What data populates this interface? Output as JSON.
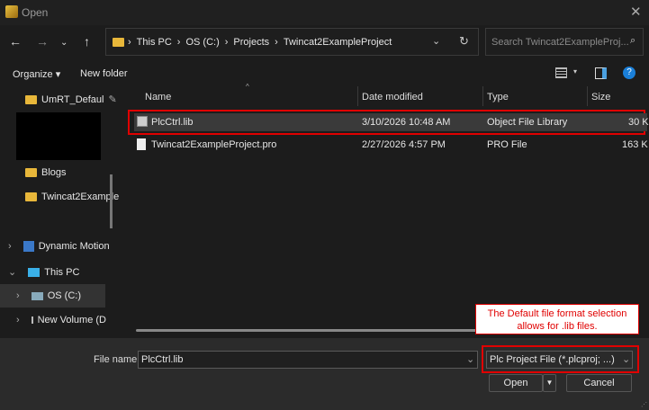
{
  "window": {
    "title": "Open"
  },
  "address": {
    "crumbs": [
      "This PC",
      "OS (C:)",
      "Projects",
      "Twincat2ExampleProject"
    ],
    "search_placeholder": "Search Twincat2ExampleProj..."
  },
  "toolbar": {
    "organize": "Organize",
    "new_folder": "New folder"
  },
  "sidebar": {
    "items": [
      {
        "label": "UmRT_Defaul",
        "icon": "folder-icon"
      },
      {
        "label": "Blogs",
        "icon": "folder-icon"
      },
      {
        "label": "Twincat2Example",
        "icon": "folder-icon"
      },
      {
        "label": "Dynamic Motion",
        "icon": "cloud-folder-icon"
      },
      {
        "label": "This PC",
        "icon": "computer-icon"
      },
      {
        "label": "OS (C:)",
        "icon": "drive-icon"
      },
      {
        "label": "New Volume (D",
        "icon": "drive-icon"
      }
    ]
  },
  "columns": [
    "Name",
    "Date modified",
    "Type",
    "Size"
  ],
  "files": [
    {
      "name": "PlcCtrl.lib",
      "date": "3/10/2026 10:48 AM",
      "type": "Object File Library",
      "size": "30 K"
    },
    {
      "name": "Twincat2ExampleProject.pro",
      "date": "2/27/2026 4:57 PM",
      "type": "PRO File",
      "size": "163 K"
    }
  ],
  "bottom": {
    "file_name_label": "File name:",
    "file_name_value": "PlcCtrl.lib",
    "filter": "Plc Project File (*.plcproj; ...)",
    "open": "Open",
    "cancel": "Cancel"
  },
  "annotation": {
    "line1": "The Default file format selection",
    "line2": "allows for .lib files."
  },
  "colors": {
    "highlight": "#e00000",
    "selected_row": "#3a3a3a"
  }
}
